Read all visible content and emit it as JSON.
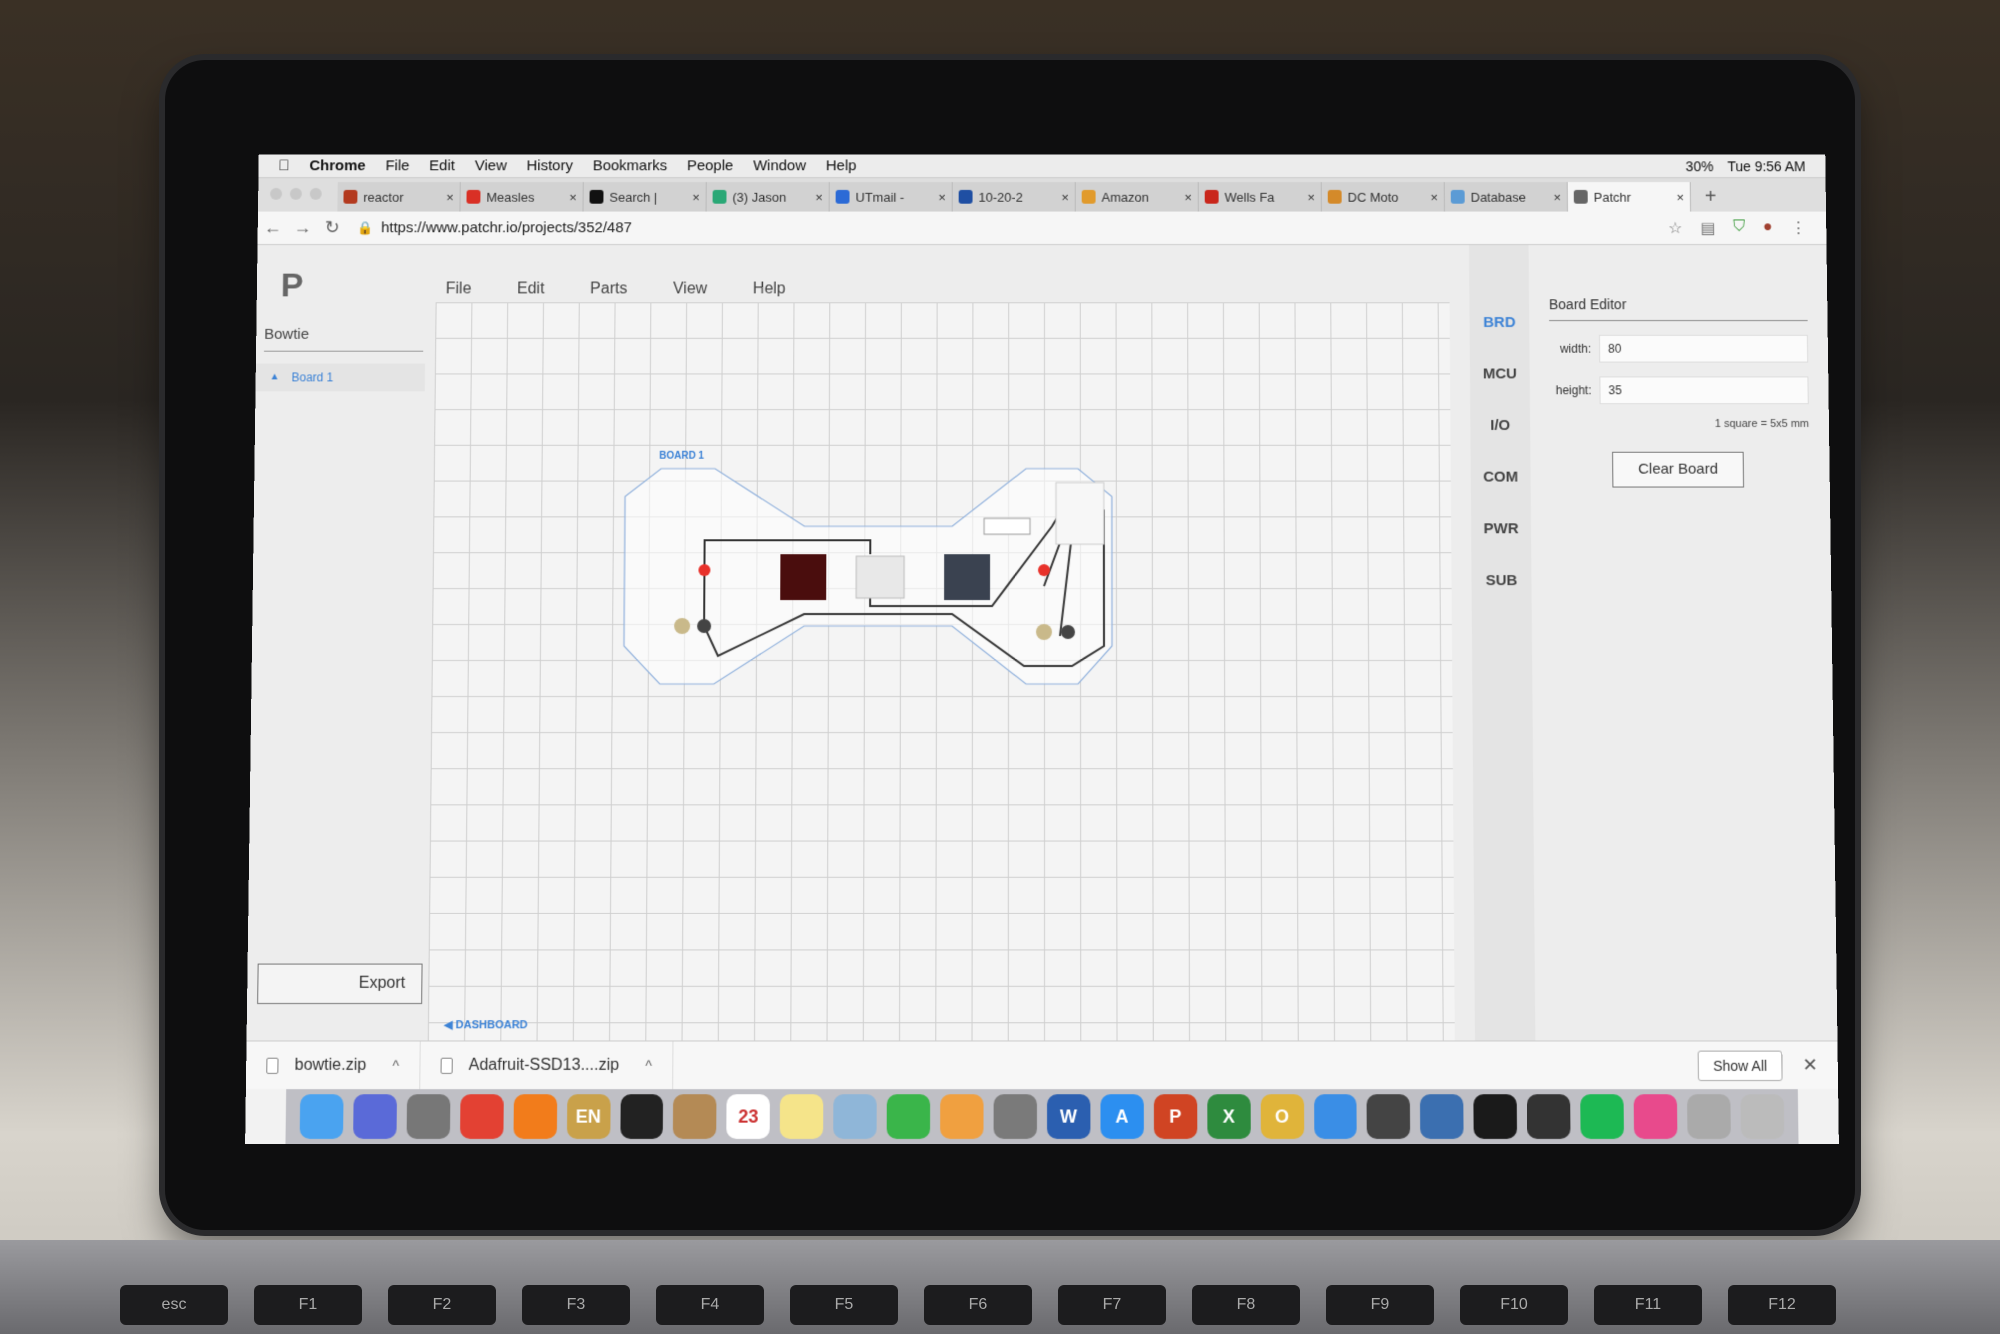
{
  "menubar": {
    "apple": "",
    "app": "Chrome",
    "items": [
      "File",
      "Edit",
      "View",
      "History",
      "Bookmarks",
      "People",
      "Window",
      "Help"
    ],
    "battery": "30%",
    "clock": "Tue 9:56 AM"
  },
  "tabs": [
    {
      "label": "reactor",
      "color": "#b33a1f"
    },
    {
      "label": "Measles",
      "color": "#d93025"
    },
    {
      "label": "Search |",
      "color": "#111111"
    },
    {
      "label": "(3) Jason",
      "color": "#2aa876"
    },
    {
      "label": "UTmail -",
      "color": "#2b6ad6"
    },
    {
      "label": "10-20-2",
      "color": "#1f4fa3"
    },
    {
      "label": "Amazon",
      "color": "#e19b2d"
    },
    {
      "label": "Wells Fa",
      "color": "#c9261b"
    },
    {
      "label": "DC Moto",
      "color": "#d48a2a"
    },
    {
      "label": "Database",
      "color": "#5b9bd5"
    },
    {
      "label": "Patchr",
      "color": "#666666",
      "active": true
    }
  ],
  "tab_new": "+",
  "tab_close": "×",
  "address": {
    "url": "https://www.patchr.io/projects/352/487",
    "lock": "🔒"
  },
  "nav": {
    "back": "←",
    "forward": "→",
    "reload": "↻"
  },
  "app": {
    "logo": "P",
    "menu": [
      "File",
      "Edit",
      "Parts",
      "View",
      "Help"
    ],
    "project_name": "Bowtie",
    "board_item": "Board 1",
    "board_caret": "▲",
    "export_label": "Export",
    "dashboard_label": "DASHBOARD",
    "dashboard_caret": "◀",
    "board_label": "BOARD 1",
    "rail": [
      "BRD",
      "MCU",
      "I/O",
      "COM",
      "PWR",
      "SUB"
    ],
    "rail_active": "BRD",
    "editor": {
      "title": "Board Editor",
      "width_label": "width:",
      "width_value": "80",
      "height_label": "height:",
      "height_value": "35",
      "scale_note": "1 square = 5x5 mm",
      "clear_label": "Clear Board"
    }
  },
  "downloads": [
    {
      "file": "bowtie.zip"
    },
    {
      "file": "Adafruit-SSD13....zip"
    }
  ],
  "download_caret": "^",
  "show_all": "Show All",
  "shelf_close": "✕",
  "dock": [
    {
      "name": "finder-icon",
      "color": "#4aa3f0"
    },
    {
      "name": "siri-icon",
      "color": "#5a6ad8"
    },
    {
      "name": "launchpad-icon",
      "color": "#777"
    },
    {
      "name": "chrome-icon",
      "color": "#e34133"
    },
    {
      "name": "firefox-icon",
      "color": "#f27c1b"
    },
    {
      "name": "dictionary-icon",
      "color": "#c9a14a",
      "label": "EN"
    },
    {
      "name": "terminal-icon",
      "color": "#222"
    },
    {
      "name": "contacts-icon",
      "color": "#b48a55"
    },
    {
      "name": "calendar-icon",
      "color": "#ffffff",
      "label": "23"
    },
    {
      "name": "notes-icon",
      "color": "#f5e48a"
    },
    {
      "name": "preview-icon",
      "color": "#8fb6d8"
    },
    {
      "name": "facetime-icon",
      "color": "#3ab54a"
    },
    {
      "name": "photos-icon",
      "color": "#f0a040"
    },
    {
      "name": "system-preferences-icon",
      "color": "#7a7a7a"
    },
    {
      "name": "word-icon",
      "color": "#2b5fb0",
      "label": "W"
    },
    {
      "name": "app-store-icon",
      "color": "#2c8ff0",
      "label": "A"
    },
    {
      "name": "powerpoint-icon",
      "color": "#d04423",
      "label": "P"
    },
    {
      "name": "excel-icon",
      "color": "#2e8b3e",
      "label": "X"
    },
    {
      "name": "outlook-icon",
      "color": "#e0b43a",
      "label": "O"
    },
    {
      "name": "safari-icon",
      "color": "#3a8ee6"
    },
    {
      "name": "camera-icon",
      "color": "#444"
    },
    {
      "name": "app-grid-icon",
      "color": "#3b6fb0"
    },
    {
      "name": "acrobat-icon",
      "color": "#1a1a1a"
    },
    {
      "name": "compass-icon",
      "color": "#333"
    },
    {
      "name": "spotify-icon",
      "color": "#1db954"
    },
    {
      "name": "itunes-icon",
      "color": "#e84a8c"
    },
    {
      "name": "downloads-stack-icon",
      "color": "#aaa"
    },
    {
      "name": "trash-icon",
      "color": "#bbb"
    }
  ],
  "keyboard": [
    "esc",
    "F1",
    "F2",
    "F3",
    "F4",
    "F5",
    "F6",
    "F7",
    "F8",
    "F9",
    "F10",
    "F11",
    "F12"
  ]
}
